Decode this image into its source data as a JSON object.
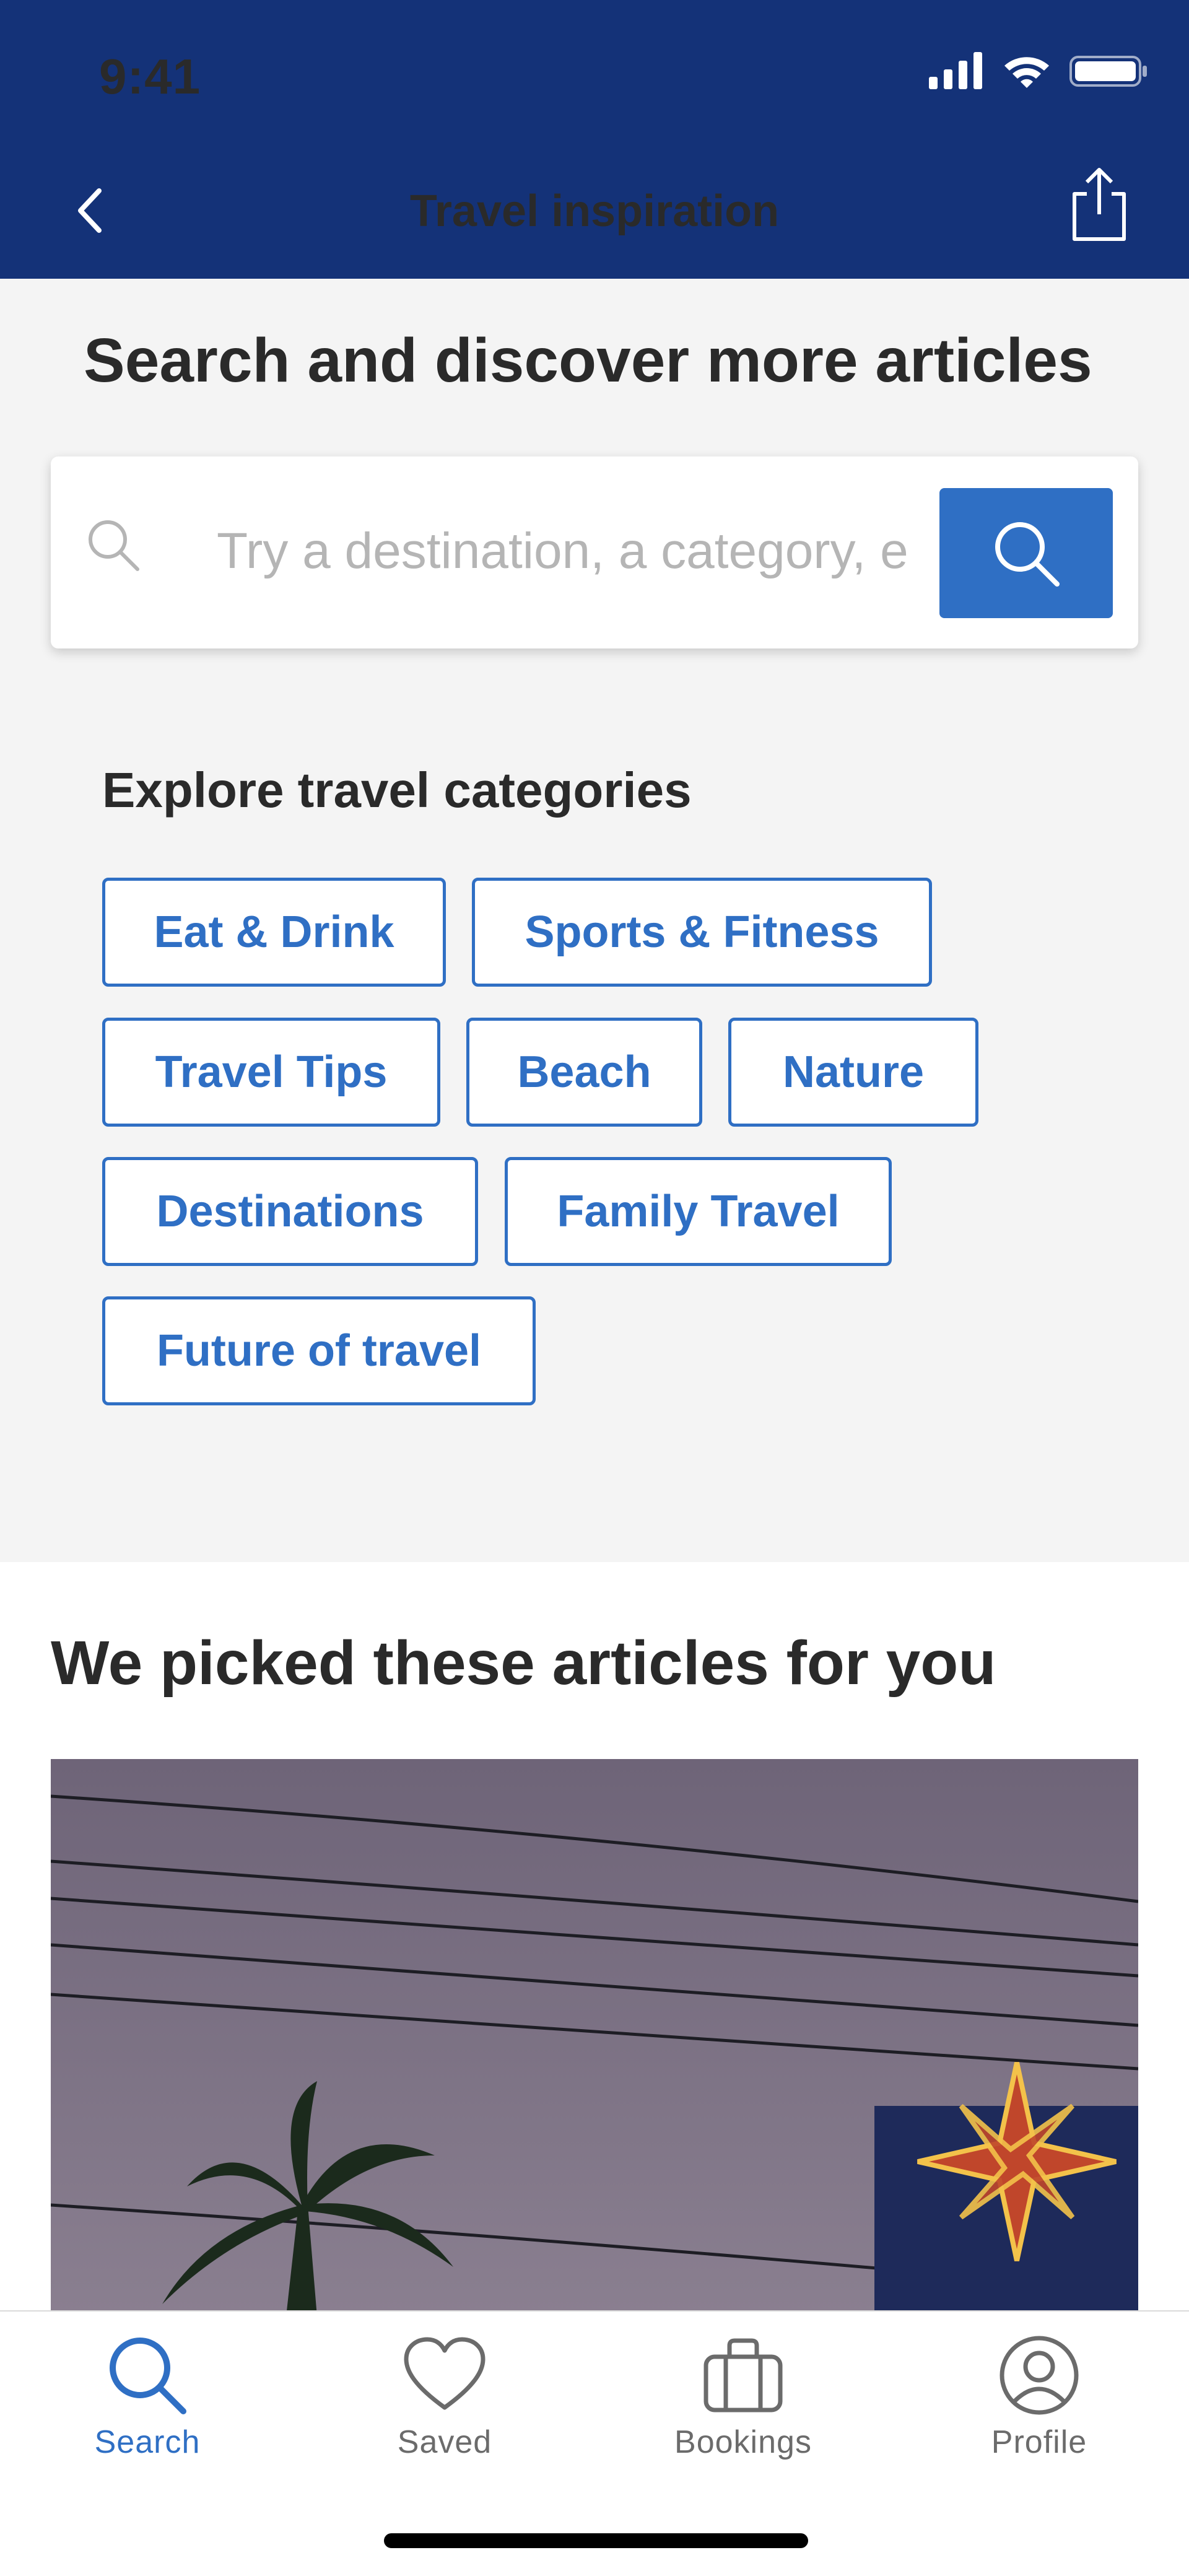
{
  "status_bar": {
    "time": "9:41"
  },
  "header": {
    "title": "Travel inspiration"
  },
  "search": {
    "heading": "Search and discover more articles",
    "placeholder": "Try a destination, a category, e"
  },
  "categories": {
    "heading": "Explore travel categories",
    "items": [
      "Eat & Drink",
      "Sports & Fitness",
      "Travel Tips",
      "Beach",
      "Nature",
      "Destinations",
      "Family Travel",
      "Future of travel"
    ]
  },
  "articles": {
    "heading": "We picked these articles for you"
  },
  "tab_bar": {
    "active": "Search",
    "items": [
      {
        "label": "Search",
        "icon": "search-icon"
      },
      {
        "label": "Saved",
        "icon": "heart-icon"
      },
      {
        "label": "Bookings",
        "icon": "briefcase-icon"
      },
      {
        "label": "Profile",
        "icon": "profile-icon"
      }
    ]
  },
  "colors": {
    "header_bg": "#143278",
    "accent": "#2f6fc4",
    "page_bg": "#f4f4f4"
  }
}
